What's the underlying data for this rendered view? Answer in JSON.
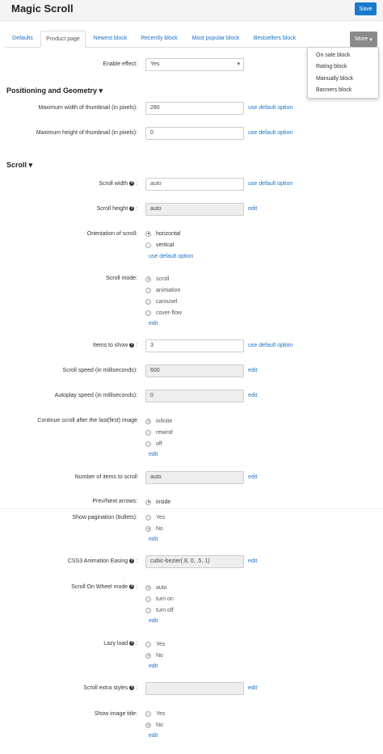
{
  "header": {
    "title": "Magic Scroll",
    "save_label": "Save"
  },
  "tabs": [
    "Defaults",
    "Product page",
    "Newest block",
    "Recently block",
    "Most popular block",
    "Bestsellers block"
  ],
  "more": {
    "label": "More",
    "items": [
      "On sale block",
      "Rating block",
      "Manually block",
      "Banners block"
    ]
  },
  "enable_effect": {
    "label": "Enable effect:",
    "value": "Yes"
  },
  "sec_positioning": "Positioning and Geometry",
  "max_width": {
    "label": "Maximum width of thumbnail (in pixels):",
    "value": "280",
    "link": "use default option"
  },
  "max_height": {
    "label": "Maximum height of thumbnail (in pixels):",
    "value": "0",
    "link": "use default option"
  },
  "sec_scroll": "Scroll",
  "scroll_width": {
    "label": "Scroll width",
    "value": "auto",
    "link": "use default option"
  },
  "scroll_height": {
    "label": "Scroll height",
    "value": "auto",
    "link": "edit"
  },
  "orientation": {
    "label": "Orientation of scroll:",
    "options": [
      "horizontal",
      "vertical"
    ],
    "link": "use default option"
  },
  "scroll_mode": {
    "label": "Scroll mode:",
    "options": [
      "scroll",
      "animation",
      "carousel",
      "cover-flow"
    ],
    "link": "edit"
  },
  "items_to_show": {
    "label": "Items to show",
    "value": "3",
    "link": "use default option"
  },
  "scroll_speed": {
    "label": "Scroll speed (in milliseconds):",
    "value": "600",
    "link": "edit"
  },
  "autoplay_speed": {
    "label": "Autoplay speed (in milliseconds):",
    "value": "0",
    "link": "edit"
  },
  "continue_scroll": {
    "label": "Continue scroll after the last(first) image",
    "options": [
      "infinite",
      "rewind",
      "off"
    ],
    "link": "edit"
  },
  "items_to_scroll": {
    "label": "Number of items to scroll",
    "value": "auto",
    "link": "edit"
  },
  "prev_next": {
    "label": "Prev/Next arrows:",
    "options": [
      "inside"
    ]
  },
  "pagination": {
    "label": "Show pagination (bullets):",
    "options": [
      "Yes",
      "No"
    ],
    "link": "edit"
  },
  "easing": {
    "label": "CSS3 Animation Easing",
    "value": "cubic-bezier(.8, 0, .5, 1)",
    "link": "edit"
  },
  "wheel_mode": {
    "label": "Scroll On Wheel mode",
    "options": [
      "auto",
      "turn on",
      "turn off"
    ],
    "link": "edit"
  },
  "lazy_load": {
    "label": "Lazy load",
    "options": [
      "Yes",
      "No"
    ],
    "link": "edit"
  },
  "extra_styles": {
    "label": "Scroll extra styles",
    "value": "",
    "link": "edit"
  },
  "image_title": {
    "label": "Show image title:",
    "options": [
      "Yes",
      "No"
    ],
    "link": "edit"
  },
  "colors": {
    "accent": "#1a7acd",
    "link": "#1a73c8",
    "more_button": "#8a8a8a"
  }
}
